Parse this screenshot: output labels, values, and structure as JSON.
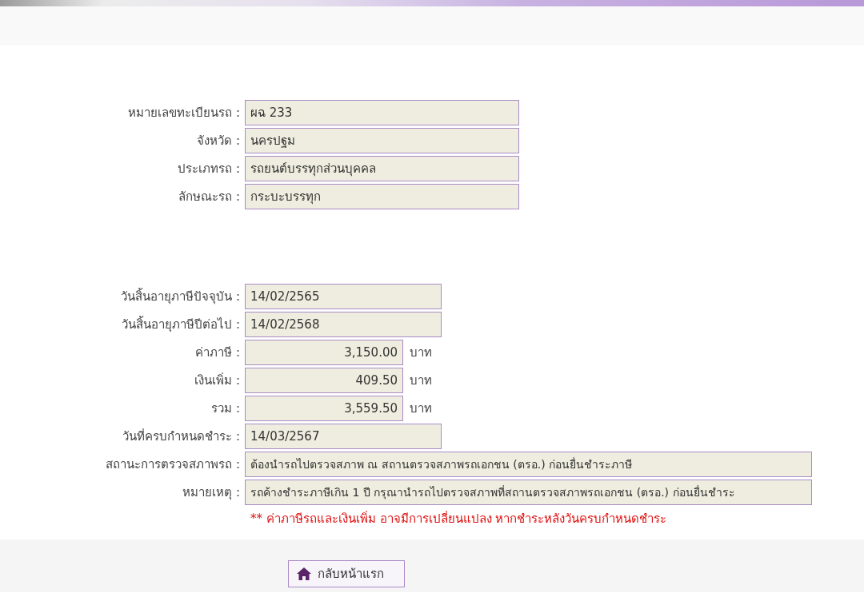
{
  "vehicle_fields": [
    {
      "label": "หมายเลขทะเบียนรถ :",
      "value": "ผฉ 233",
      "kind": "wide"
    },
    {
      "label": "จังหวัด :",
      "value": "นครปฐม",
      "kind": "wide"
    },
    {
      "label": "ประเภทรถ :",
      "value": "รถยนต์บรรทุกส่วนบุคคล",
      "kind": "wide"
    },
    {
      "label": "ลักษณะรถ :",
      "value": "กระบะบรรทุก",
      "kind": "wide"
    }
  ],
  "tax_fields": [
    {
      "label": "วันสิ้นอายุภาษีปัจจุบัน :",
      "value": "14/02/2565",
      "kind": "date"
    },
    {
      "label": "วันสิ้นอายุภาษีปีต่อไป :",
      "value": "14/02/2568",
      "kind": "date"
    },
    {
      "label": "ค่าภาษี :",
      "value": "3,150.00",
      "kind": "amount",
      "unit": "บาท"
    },
    {
      "label": "เงินเพิ่ม :",
      "value": "409.50",
      "kind": "amount",
      "unit": "บาท"
    },
    {
      "label": "รวม :",
      "value": "3,559.50",
      "kind": "amount",
      "unit": "บาท"
    },
    {
      "label": "วันที่ครบกำหนดชำระ :",
      "value": "14/03/2567",
      "kind": "date"
    },
    {
      "label": "สถานะการตรวจสภาพรถ :",
      "value": "ต้องนำรถไปตรวจสภาพ ณ สถานตรวจสภาพรถเอกชน (ตรอ.) ก่อนยื่นชำระภาษี",
      "kind": "long"
    },
    {
      "label": "หมายเหตุ :",
      "value": "รถค้างชำระภาษีเกิน 1 ปี กรุณานำรถไปตรวจสภาพที่สถานตรวจสภาพรถเอกชน (ตรอ.) ก่อนยื่นชำระ",
      "kind": "long"
    }
  ],
  "warning": "** ค่าภาษีรถและเงินเพิ่ม อาจมีการเปลี่ยนแปลง หากชำระหลังวันครบกำหนดชำระ",
  "home_button": {
    "label": "กลับหน้าแรก"
  }
}
